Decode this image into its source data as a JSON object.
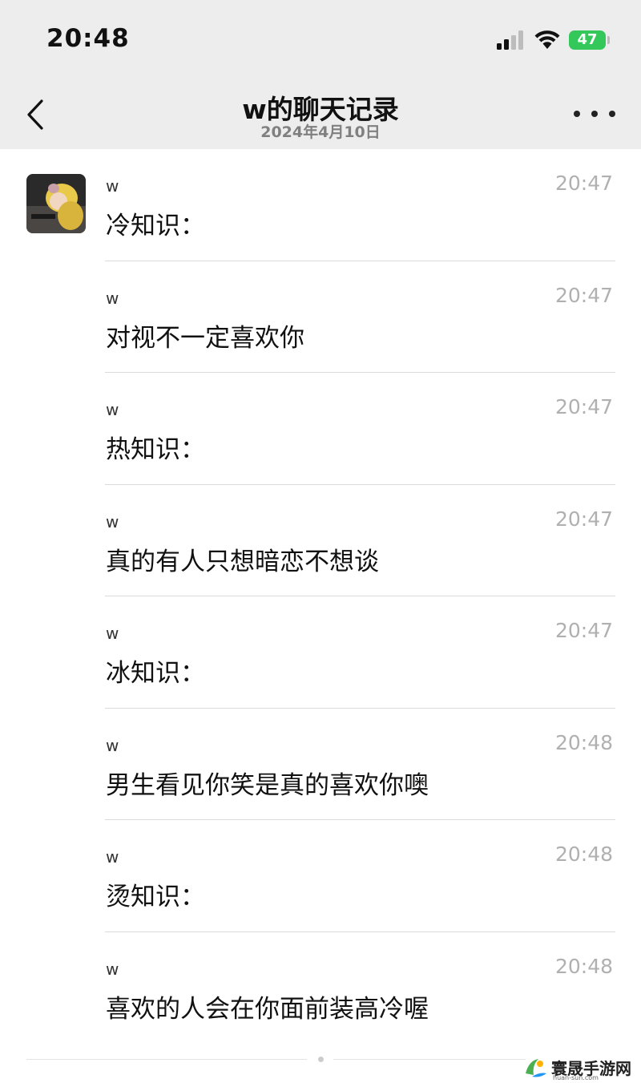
{
  "status_bar": {
    "time": "20:48",
    "battery": "47",
    "icons": [
      "cellular-signal-icon",
      "wifi-icon",
      "battery-charging-icon"
    ],
    "battery_color": "#34c759"
  },
  "nav": {
    "back_icon": "chevron-left-icon",
    "title": "w的聊天记录",
    "date": "2024年4月10日",
    "more_icon": "ellipsis-icon"
  },
  "messages": [
    {
      "sender": "w",
      "time": "20:47",
      "text": "冷知识："
    },
    {
      "sender": "w",
      "time": "20:47",
      "text": "对视不一定喜欢你"
    },
    {
      "sender": "w",
      "time": "20:47",
      "text": "热知识："
    },
    {
      "sender": "w",
      "time": "20:47",
      "text": "真的有人只想暗恋不想谈"
    },
    {
      "sender": "w",
      "time": "20:47",
      "text": "冰知识："
    },
    {
      "sender": "w",
      "time": "20:48",
      "text": "男生看见你笑是真的喜欢你噢"
    },
    {
      "sender": "w",
      "time": "20:48",
      "text": "烫知识："
    },
    {
      "sender": "w",
      "time": "20:48",
      "text": "喜欢的人会在你面前装高冷喔"
    }
  ],
  "watermark": {
    "name": "寰晟手游网",
    "url": "huan-sun.com"
  },
  "colors": {
    "header_bg": "#ededed",
    "divider": "#dadada",
    "time_text": "#b0b0b0"
  }
}
